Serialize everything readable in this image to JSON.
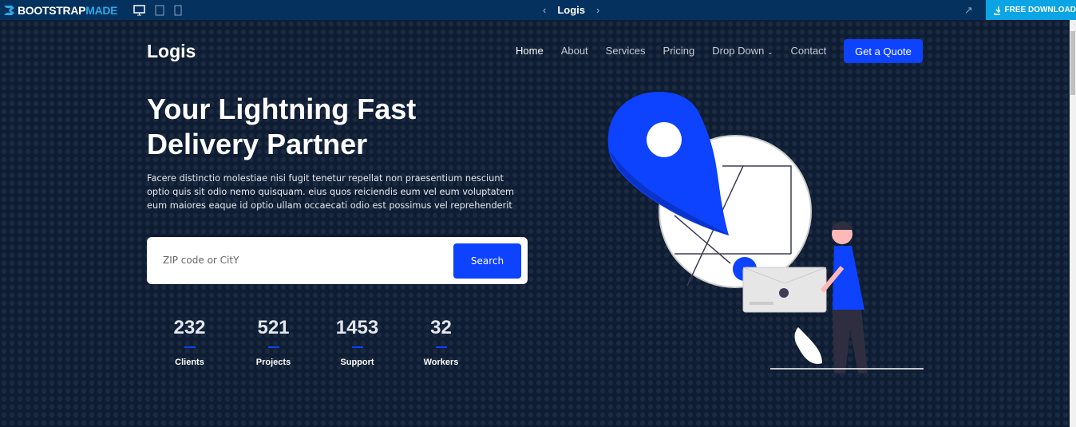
{
  "topbar": {
    "brand_main": "BOOTSTRAP",
    "brand_accent": "MADE",
    "title": "Logis",
    "download_label": "FREE DOWNLOAD",
    "icons": [
      "desktop-icon",
      "tablet-icon",
      "mobile-icon",
      "external-link-icon",
      "download-icon"
    ]
  },
  "header": {
    "logo": "Logis",
    "nav": [
      {
        "label": "Home",
        "active": true
      },
      {
        "label": "About"
      },
      {
        "label": "Services"
      },
      {
        "label": "Pricing"
      },
      {
        "label": "Drop Down"
      },
      {
        "label": "Contact"
      }
    ],
    "cta": "Get a Quote"
  },
  "hero": {
    "title": "Your Lightning Fast Delivery Partner",
    "description": "Facere distinctio molestiae nisi fugit tenetur repellat non praesentium nesciunt optio quis sit odio nemo quisquam. eius quos reiciendis eum vel eum voluptatem eum maiores eaque id optio ullam occaecati odio est possimus vel reprehenderit",
    "search_placeholder": "ZIP code or CitY",
    "search_button": "Search"
  },
  "stats": [
    {
      "value": "232",
      "label": "Clients"
    },
    {
      "value": "521",
      "label": "Projects"
    },
    {
      "value": "1453",
      "label": "Support"
    },
    {
      "value": "32",
      "label": "Workers"
    }
  ],
  "colors": {
    "background": "#0e1d34",
    "accent": "#0d42ff",
    "topbar": "#05315f",
    "download": "#0ba5e6"
  }
}
